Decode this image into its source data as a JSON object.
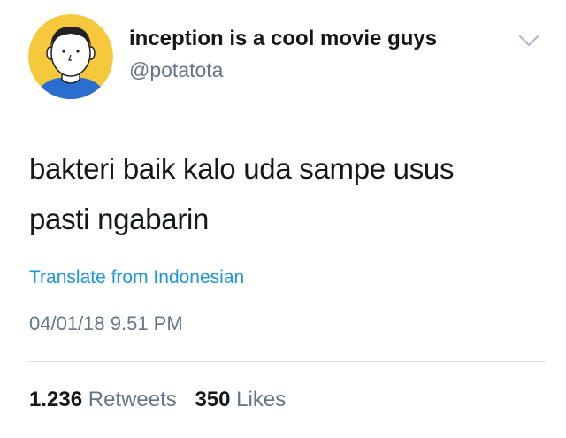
{
  "author": {
    "display_name": "inception is a cool movie guys",
    "handle": "@potatota",
    "avatar_icon": "cartoon-face-avatar",
    "avatar_bg": "#f5c93b"
  },
  "menu_icon": "chevron-down-icon",
  "tweet": {
    "text_line1": "bakteri baik kalo uda sampe usus",
    "text_line2": "pasti ngabarin",
    "translate_label": "Translate from Indonesian",
    "timestamp": "04/01/18 9.51 PM"
  },
  "stats": {
    "retweets_count": "1.236",
    "retweets_label": "Retweets",
    "likes_count": "350",
    "likes_label": "Likes"
  },
  "colors": {
    "link": "#1b95e0",
    "text": "#14171a",
    "secondary": "#657786"
  }
}
